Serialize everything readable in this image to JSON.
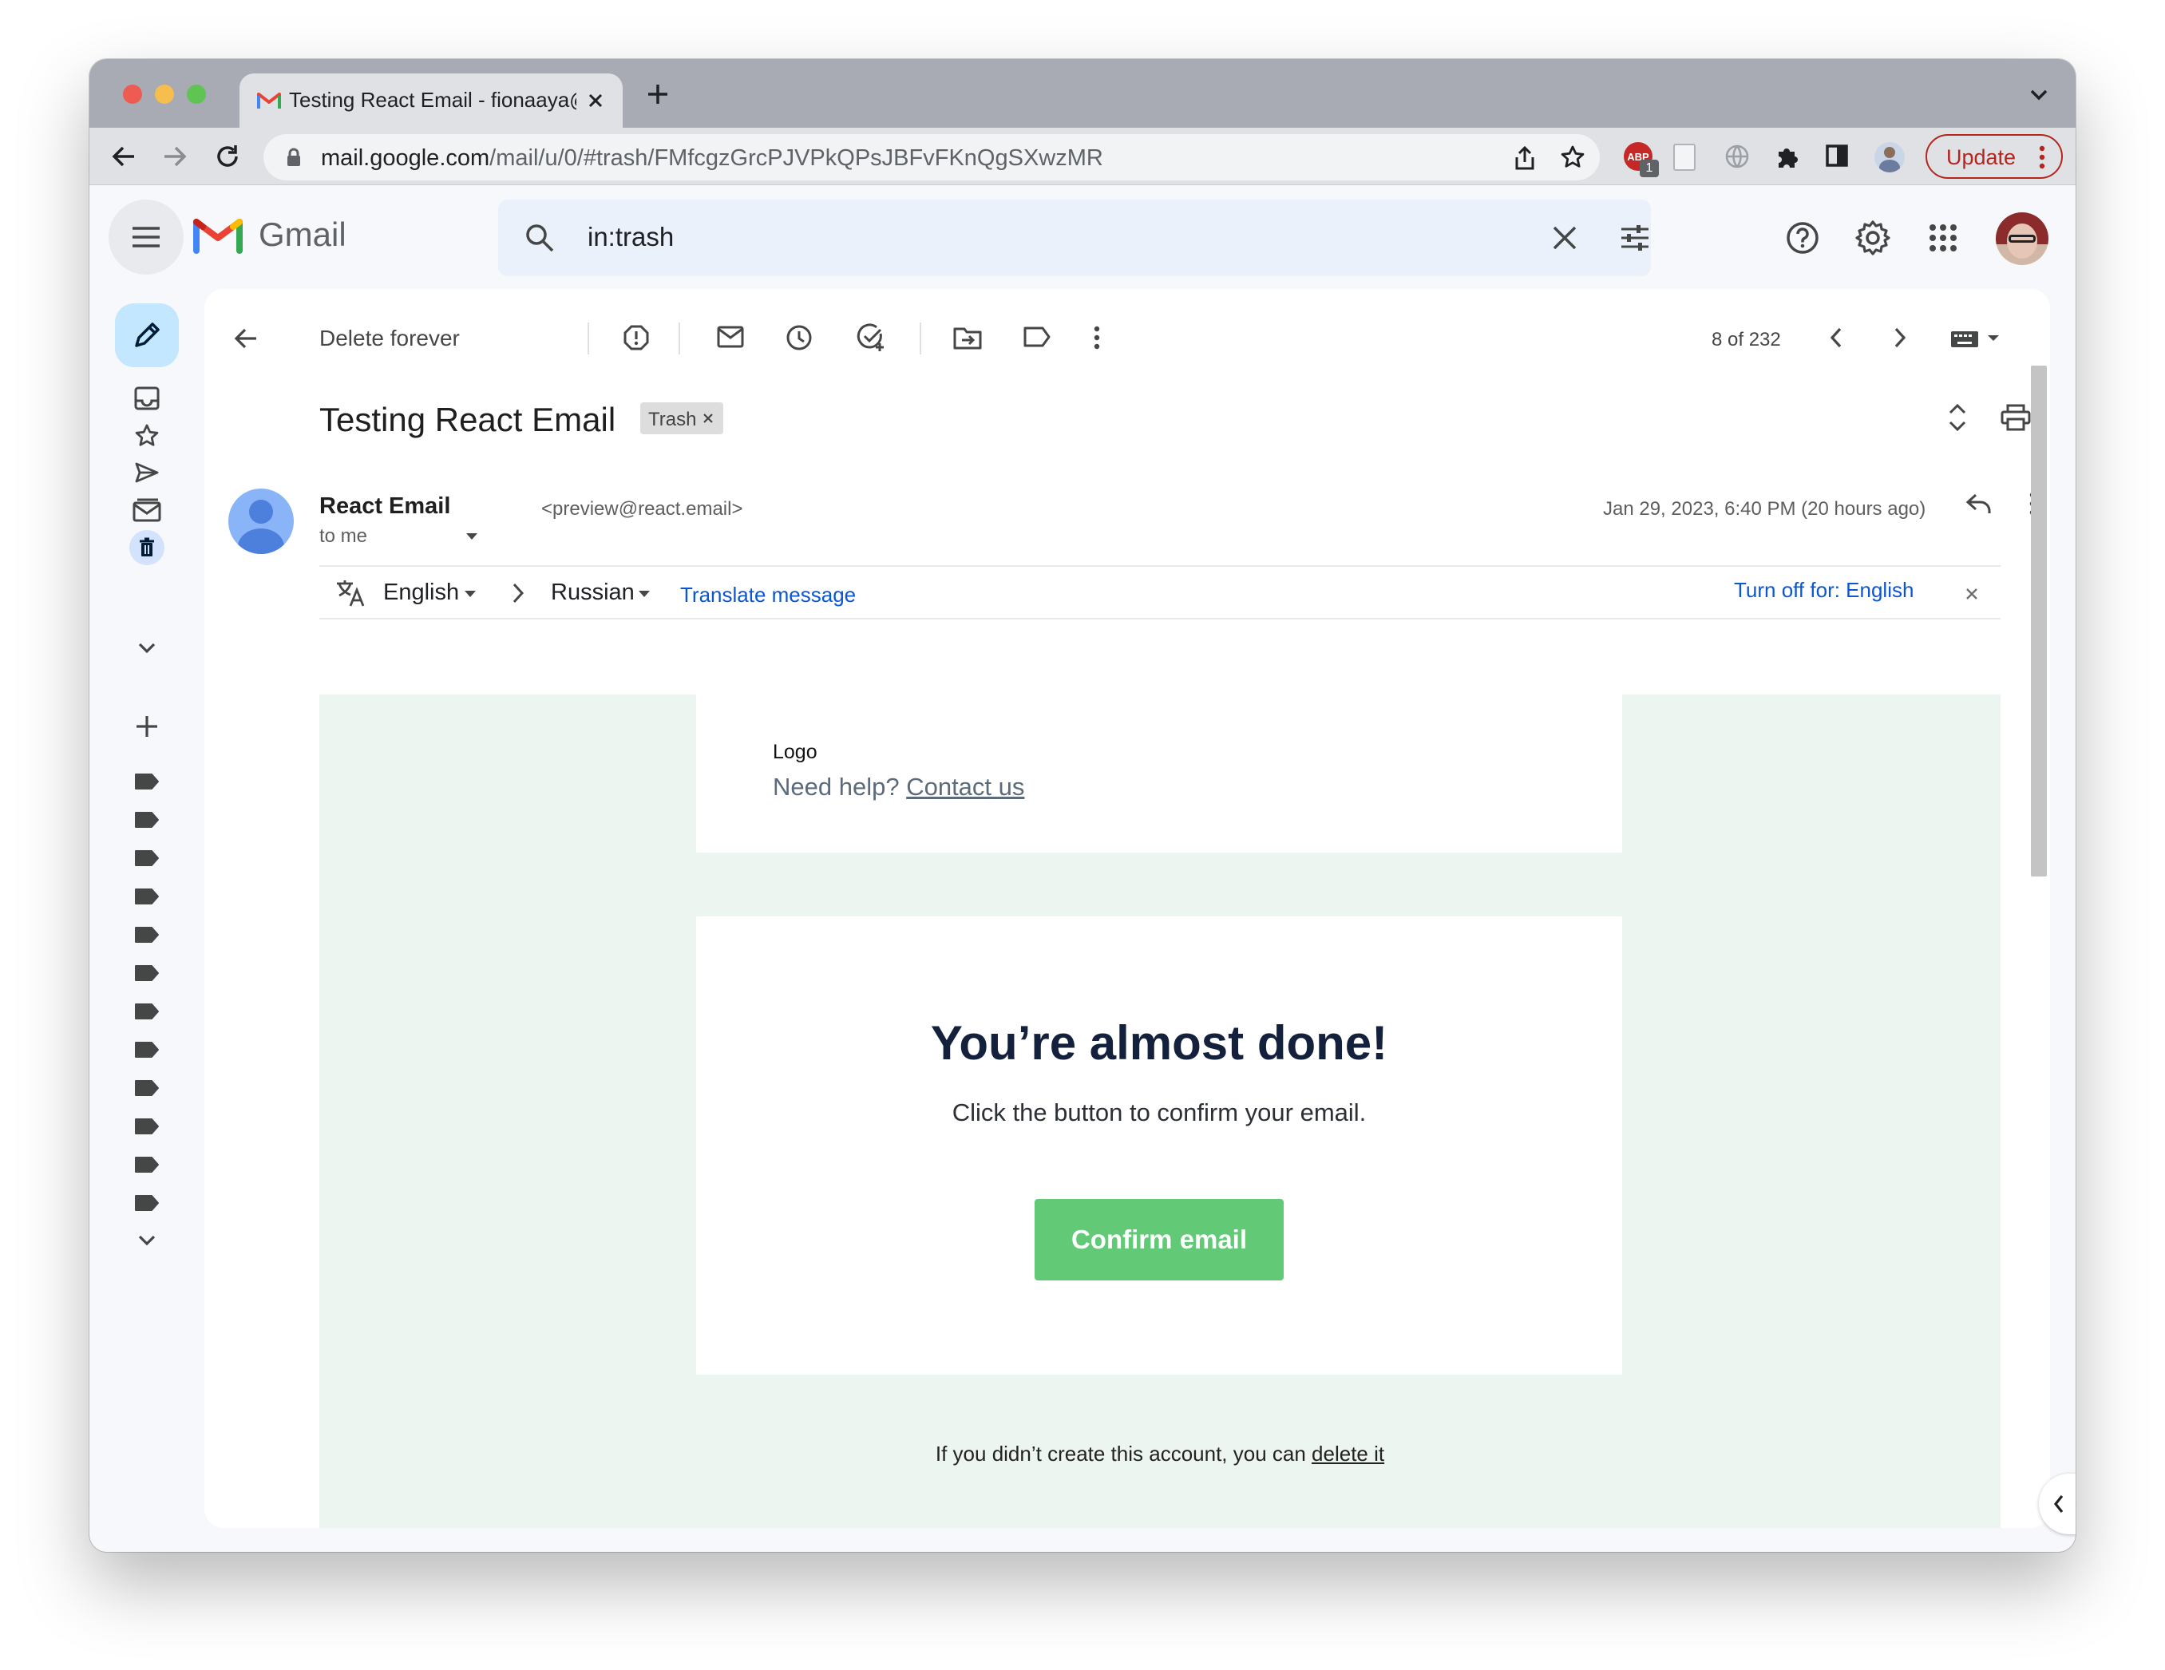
{
  "browser": {
    "tab_title": "Testing React Email - fionaaya@",
    "url_host": "mail.google.com",
    "url_path": "/mail/u/0/#trash/FMfcgzGrcPJVPkQPsJBFvFKnQgSXwzMR",
    "update_label": "Update",
    "extension_badge": "1",
    "extension_label": "ABP"
  },
  "gmail": {
    "brand": "Gmail",
    "search_value": "in:trash"
  },
  "toolbar": {
    "delete_forever_label": "Delete forever",
    "pagination": "8 of 232"
  },
  "message": {
    "subject": "Testing React Email",
    "label_chip": "Trash",
    "sender_name": "React Email",
    "sender_email": "<preview@react.email>",
    "recipient": "to me",
    "date": "Jan 29, 2023, 6:40 PM (20 hours ago)"
  },
  "translate": {
    "from_language": "English",
    "to_language": "Russian",
    "translate_link": "Translate message",
    "turn_off": "Turn off for: English"
  },
  "email": {
    "logo_text": "Logo",
    "help_text": "Need help?",
    "contact_link": "Contact us",
    "heading": "You’re almost done!",
    "body": "Click the button to confirm your email.",
    "cta": "Confirm email",
    "footer_text": "If you didn’t create this account, you can",
    "footer_link": "delete it"
  },
  "colors": {
    "accent_green": "#62c977",
    "email_background": "#edf5f1",
    "link_blue": "#0b57d0",
    "compose_bg": "#c2e7ff"
  }
}
